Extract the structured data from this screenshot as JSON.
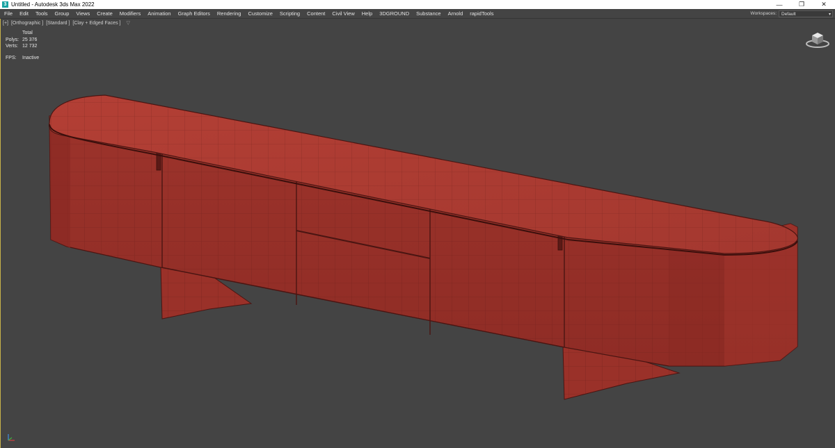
{
  "window": {
    "title": "Untitled - Autodesk 3ds Max 2022",
    "app_icon_letter": "3",
    "controls": {
      "minimize": "—",
      "restore": "❐",
      "close": "✕"
    }
  },
  "menu": {
    "items": [
      "File",
      "Edit",
      "Tools",
      "Group",
      "Views",
      "Create",
      "Modifiers",
      "Animation",
      "Graph Editors",
      "Rendering",
      "Customize",
      "Scripting",
      "Content",
      "Civil View",
      "Help",
      "3DGROUND",
      "Substance",
      "Arnold",
      "rapidTools"
    ]
  },
  "workspaces": {
    "label": "Workspaces:",
    "value": "Default",
    "arrow": "▾"
  },
  "viewport": {
    "labels": [
      "[+]",
      "[Orthographic ]",
      "[Standard ]",
      "[Clay + Edged Faces ]"
    ],
    "filter_icon": "▽",
    "stats": {
      "total_label": "Total",
      "polys_label": "Polys:",
      "polys_value": "25 376",
      "verts_label": "Verts:",
      "verts_value": "12 732"
    },
    "fps": {
      "label": "FPS:",
      "value": "Inactive"
    }
  },
  "colors": {
    "model_fill": "#a8382f",
    "model_dark": "#7f2520",
    "wire": "#4a1512",
    "viewport_bg": "#444444"
  }
}
